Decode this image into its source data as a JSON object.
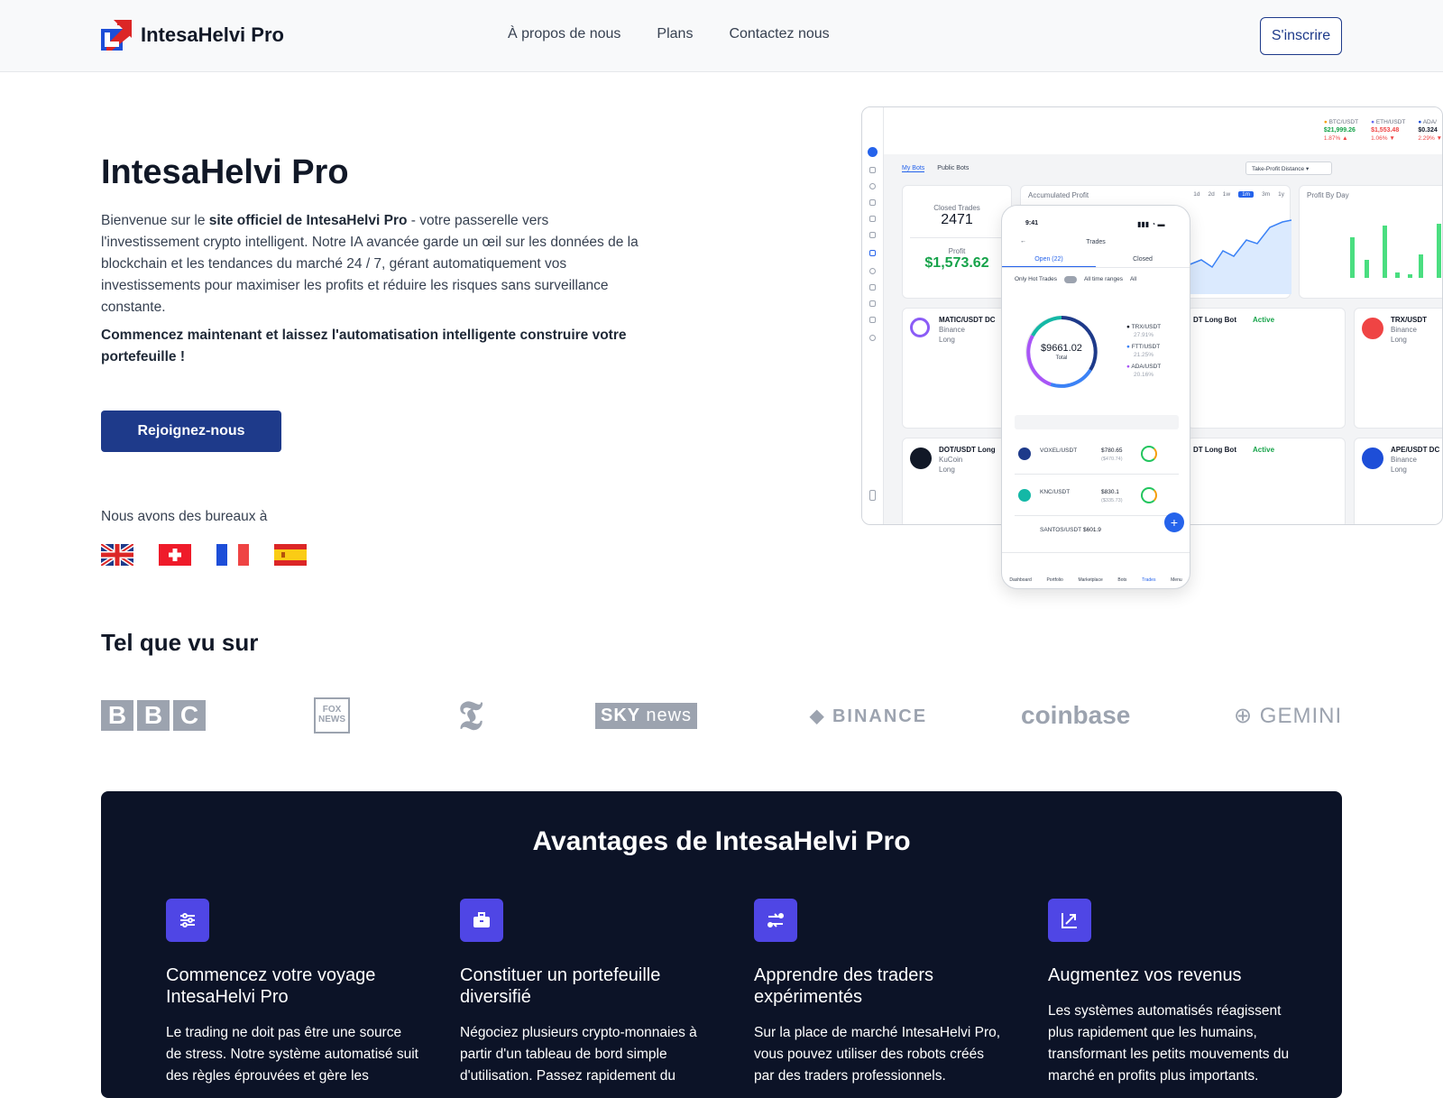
{
  "header": {
    "brand": "IntesaHelvi Pro",
    "nav": [
      "À propos de nous",
      "Plans",
      "Contactez nous"
    ],
    "signup_label": "S'inscrire"
  },
  "hero": {
    "title": "IntesaHelvi Pro",
    "intro_pre": "Bienvenue sur le ",
    "intro_bold": "site officiel de IntesaHelvi Pro",
    "intro_post": " - votre passerelle vers l'investissement crypto intelligent. Notre IA avancée garde un œil sur les données de la blockchain et les tendances du marché 24 / 7, gérant automatiquement vos investissements pour maximiser les profits et réduire les risques sans surveillance constante.",
    "cta_text": "Commencez maintenant et laissez l'automatisation intelligente construire votre portefeuille !",
    "join_label": "Rejoignez-nous",
    "offices_label": "Nous avons des bureaux à"
  },
  "dashboard": {
    "tickers": [
      {
        "pair": "BTC/USDT",
        "price": "$21,999.26",
        "change": "1.87% ▲",
        "color": "#16a34a"
      },
      {
        "pair": "ETH/USDT",
        "price": "$1,553.48",
        "change": "1.06% ▼",
        "color": "#ef4444"
      },
      {
        "pair": "ADA/",
        "price": "$0.324",
        "change": "2.29% ▼",
        "color": "#ef4444"
      }
    ],
    "tabs": [
      "My Bots",
      "Public Bots"
    ],
    "tp_select": "Take-Profit Distance",
    "closed_trades_label": "Closed Trades",
    "closed_trades": "2471",
    "profit_label": "Profit",
    "profit": "$1,573.62",
    "accumulated_label": "Accumulated Profit",
    "ranges": [
      "1d",
      "2d",
      "1w",
      "1m",
      "3m",
      "1y"
    ],
    "profit_by_day_label": "Profit By Day",
    "bots": [
      {
        "name": "MATIC/USDT DC",
        "exchange": "Binance",
        "side": "Long"
      },
      {
        "name": "DOT/USDT Long",
        "exchange": "KuCoin",
        "side": "Long"
      },
      {
        "name": "TRX/USDT",
        "exchange": "Binance",
        "side": "Long"
      },
      {
        "name": "APE/USDT DC",
        "exchange": "Binance",
        "side": "Long"
      }
    ],
    "mid_bot": "DT Long Bot",
    "active": "Active",
    "phone": {
      "time": "9:41",
      "title": "Trades",
      "tabs": [
        "Open (22)",
        "Closed"
      ],
      "filters": [
        "Only Hot Trades",
        "All time ranges",
        "All"
      ],
      "total": "$9661.02",
      "total_label": "Total",
      "legend": [
        {
          "pair": "TRX/USDT",
          "pct": "27.91%"
        },
        {
          "pair": "FTT/USDT",
          "pct": "21.25%"
        },
        {
          "pair": "ADA/USDT",
          "pct": "20.16%"
        }
      ],
      "trades": [
        {
          "pair": "VOXEL/USDT",
          "price": "$780.65",
          "sub": "($470.74)"
        },
        {
          "pair": "KNC/USDT",
          "price": "$830.1",
          "sub": "($335.73)"
        },
        {
          "pair": "SANTOS/USDT",
          "price": "$601.9",
          "sub": ""
        }
      ],
      "nav": [
        "Dashboard",
        "Portfolio",
        "Marketplace",
        "Bots",
        "Trades",
        "Menu"
      ]
    }
  },
  "seen_on": {
    "title": "Tel que vu sur",
    "logos": [
      "BBC",
      "FOX NEWS",
      "T",
      "SKY news",
      "BINANCE",
      "coinbase",
      "GEMINI"
    ]
  },
  "advantages": {
    "title": "Avantages de IntesaHelvi Pro",
    "features": [
      {
        "icon": "sliders-icon",
        "title": "Commencez votre voyage IntesaHelvi Pro",
        "text": "Le trading ne doit pas être une source de stress. Notre système automatisé suit des règles éprouvées et gère les"
      },
      {
        "icon": "briefcase-icon",
        "title": "Constituer un portefeuille diversifié",
        "text": "Négociez plusieurs crypto-monnaies à partir d'un tableau de bord simple d'utilisation. Passez rapidement du"
      },
      {
        "icon": "exchange-icon",
        "title": "Apprendre des traders expérimentés",
        "text": "Sur la place de marché IntesaHelvi Pro, vous pouvez utiliser des robots créés par des traders professionnels."
      },
      {
        "icon": "chart-up-icon",
        "title": "Augmentez vos revenus",
        "text": "Les systèmes automatisés réagissent plus rapidement que les humains, transformant les petits mouvements du marché en profits plus importants."
      }
    ]
  },
  "colors": {
    "brand": "#1e3a8a",
    "accent": "#4f46e5",
    "dark_bg": "#0c1327",
    "logo_red": "#dc2626",
    "logo_blue": "#1d4ed8"
  }
}
